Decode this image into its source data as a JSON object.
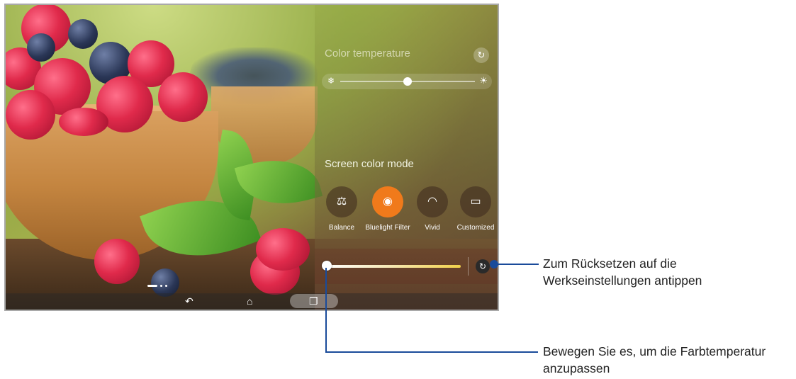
{
  "screen": {
    "color_temperature": {
      "title": "Color temperature",
      "reset_icon": "refresh-icon",
      "cold_icon": "snowflake-icon",
      "warm_icon": "sun-icon",
      "slider_level": 0.5
    },
    "screen_color_mode": {
      "title": "Screen color mode",
      "modes": [
        {
          "label": "Balance",
          "icon": "balance-scale-icon",
          "glyph": "⚖",
          "active": false
        },
        {
          "label": "Bluelight Filter",
          "icon": "eye-shield-icon",
          "glyph": "◉",
          "active": true
        },
        {
          "label": "Vivid",
          "icon": "rainbow-icon",
          "glyph": "◠",
          "active": false
        },
        {
          "label": "Customized",
          "icon": "custom-display-icon",
          "glyph": "▭",
          "active": false
        }
      ],
      "accent_color": "#f07a1b"
    },
    "adjust_slider": {
      "level": 0.0,
      "reset_icon": "refresh-icon"
    },
    "nav": {
      "back_icon": "back-icon",
      "home_icon": "home-icon",
      "recents_icon": "recents-icon"
    },
    "page_indicator": {
      "pages": 3,
      "current": 1
    }
  },
  "callouts": {
    "reset": {
      "line1": "Zum Rücksetzen auf die",
      "line2": "Werkseinstellungen antippen"
    },
    "slider": {
      "line1": "Bewegen Sie es, um die Farbtemperatur",
      "line2": "anzupassen"
    },
    "color": "#1a4b9a"
  }
}
